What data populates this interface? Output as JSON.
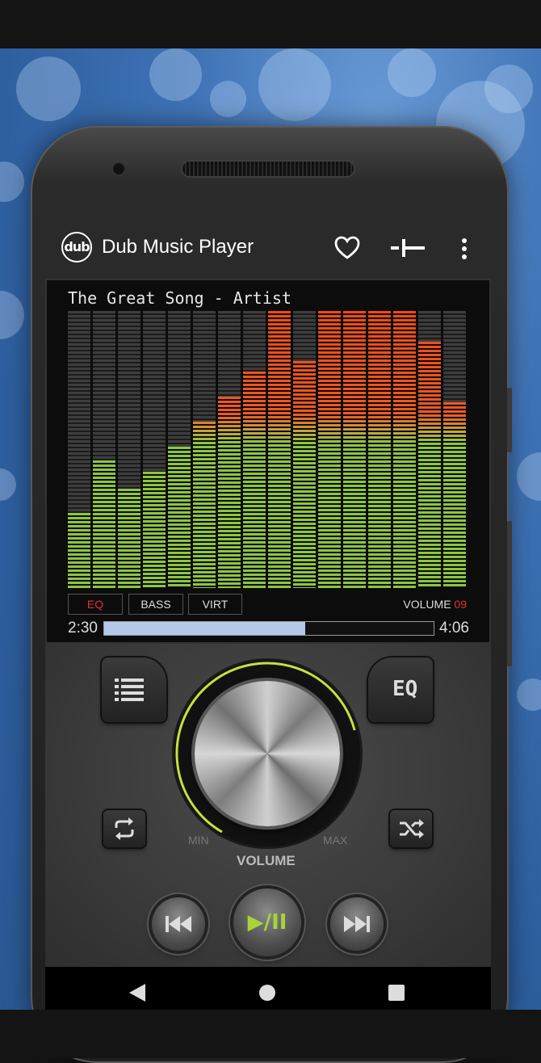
{
  "app": {
    "title": "Dub Music Player",
    "logo_text": "dub"
  },
  "toolbar": {
    "favorite_icon": "heart-outline-icon",
    "eq_toggle_icon": "slider-icon",
    "menu_icon": "more-vert-icon"
  },
  "now_playing": {
    "title": "The Great Song - Artist"
  },
  "equalizer": {
    "colors": {
      "low": "#8ec63f",
      "mid": "#c9a437",
      "high": "#f05a1e",
      "off": "#3d3d3d"
    },
    "levels": [
      0.27,
      0.46,
      0.36,
      0.42,
      0.51,
      0.6,
      0.69,
      0.78,
      1.0,
      0.82,
      1.0,
      1.0,
      1.0,
      1.0,
      0.89,
      0.67
    ]
  },
  "tabs": [
    {
      "label": "EQ",
      "active": true
    },
    {
      "label": "BASS",
      "active": false
    },
    {
      "label": "VIRT",
      "active": false
    }
  ],
  "volume": {
    "label": "VOLUME",
    "value": "09",
    "knob_label": "VOLUME",
    "min_label": "MIN",
    "max_label": "MAX",
    "level": 0.75
  },
  "progress": {
    "elapsed": "2:30",
    "total": "4:06",
    "fraction": 0.61
  },
  "controls": {
    "playlist_icon": "playlist-icon",
    "eq_label": "EQ",
    "repeat_icon": "repeat-icon",
    "shuffle_icon": "shuffle-icon",
    "prev_icon": "skip-previous-icon",
    "play_pause_label": "▶/II",
    "next_icon": "skip-next-icon"
  },
  "navbar": {
    "back_icon": "back-triangle-icon",
    "home_icon": "home-circle-icon",
    "recents_icon": "recents-square-icon"
  }
}
